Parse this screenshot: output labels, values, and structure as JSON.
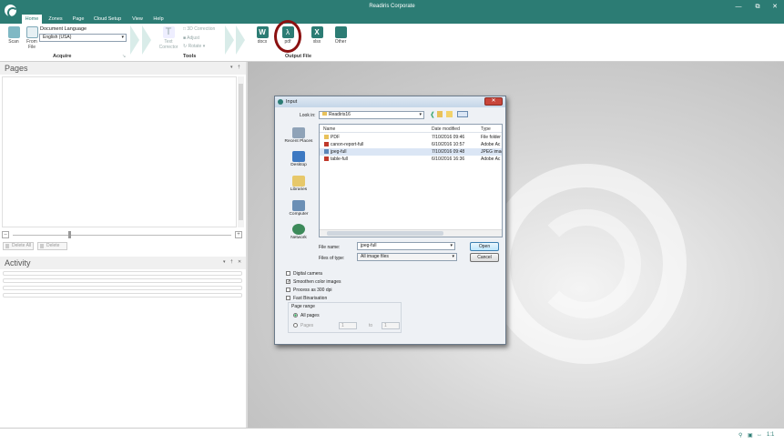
{
  "window": {
    "title": "Readiris Corporate"
  },
  "tabs": [
    "Home",
    "Zones",
    "Page",
    "Cloud Setup",
    "View",
    "Help"
  ],
  "ribbon": {
    "acquire": {
      "label": "Acquire",
      "scan": "Scan",
      "from_file": "From File",
      "doc_lang_label": "Document Language",
      "doc_lang_value": "English (USA)"
    },
    "tools": {
      "label": "Tools",
      "text_corrector": "Text Corrector",
      "correction_3d": "3D Correction",
      "adjust": "Adjust",
      "rotate": "Rotate"
    },
    "output": {
      "label": "Output File",
      "docx": "docx",
      "pdf": "pdf",
      "xlsx": "xlsx",
      "other": "Other"
    }
  },
  "pages_panel": {
    "title": "Pages",
    "delete_all": "Delete All",
    "delete": "Delete"
  },
  "activity_panel": {
    "title": "Activity"
  },
  "dialog": {
    "title": "Input",
    "look_in_label": "Look in:",
    "look_in_value": "Readiris16",
    "places": [
      "Recent Places",
      "Desktop",
      "Libraries",
      "Computer",
      "Network"
    ],
    "columns": [
      "Name",
      "Date modified",
      "Type"
    ],
    "files": [
      {
        "name": "PDF",
        "date": "7/10/2016 09:46",
        "type": "File folder",
        "icon": "folder-icon"
      },
      {
        "name": "canon-report-full",
        "date": "6/10/2016 10:57",
        "type": "Adobe Ac",
        "icon": "pdf-file-icon"
      },
      {
        "name": "jpeg-full",
        "date": "7/10/2016 09:48",
        "type": "JPEG imag",
        "icon": "image-file-icon",
        "selected": true
      },
      {
        "name": "table-full",
        "date": "6/10/2016 16:36",
        "type": "Adobe Ac",
        "icon": "pdf-file-icon"
      }
    ],
    "file_name_label": "File name:",
    "file_name_value": "jpeg-full",
    "files_type_label": "Files of type:",
    "files_type_value": "All image files",
    "open": "Open",
    "cancel": "Cancel",
    "options": [
      {
        "label": "Digital camera",
        "checked": false
      },
      {
        "label": "Smoothen color images",
        "checked": true
      },
      {
        "label": "Process as 300 dpi",
        "checked": false
      },
      {
        "label": "Fast Binarisation",
        "checked": false
      }
    ],
    "page_range": {
      "title": "Page range",
      "all_pages": "All pages",
      "pages": "Pages",
      "from": "1",
      "to_label": "to",
      "to": "1"
    }
  },
  "status": {
    "zoom": "1:1"
  },
  "colors": {
    "accent": "#2c7c74",
    "callout": "#8b1010"
  }
}
